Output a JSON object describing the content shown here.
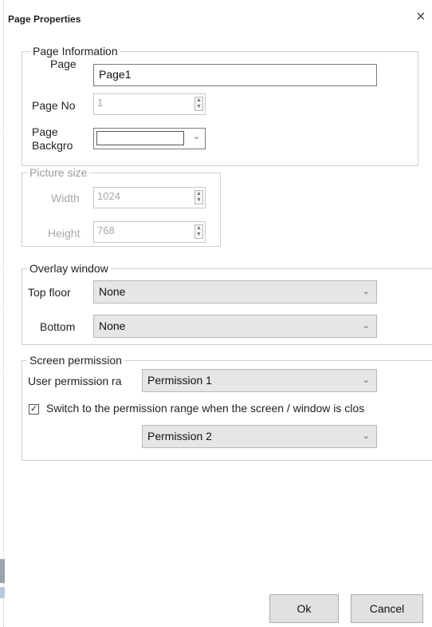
{
  "dialog": {
    "title": "Page Properties",
    "close_glyph": "×"
  },
  "page_information": {
    "legend": "Page Information",
    "page_label": "Page",
    "page_value": "Page1",
    "page_no_label": "Page No",
    "page_no_value": "1",
    "background_label_line1": "Page",
    "background_label_line2": "Backgro",
    "background_color": "#ffffff"
  },
  "picture_size": {
    "legend": "Picture size",
    "width_label": "Width",
    "width_value": "1024",
    "height_label": "Height",
    "height_value": "768"
  },
  "overlay_window": {
    "legend": "Overlay window",
    "top_label": "Top floor",
    "top_value": "None",
    "bottom_label": "Bottom",
    "bottom_value": "None"
  },
  "screen_permission": {
    "legend": "Screen permission",
    "user_perm_label": "User permission ra",
    "user_perm_value": "Permission 1",
    "switch_checked": true,
    "switch_label": "Switch to the permission range when the screen / window is clos",
    "switch_value": "Permission 2"
  },
  "buttons": {
    "ok": "Ok",
    "cancel": "Cancel"
  },
  "icons": {
    "chevron": "⌄",
    "spin_up": "▲",
    "spin_down": "▼",
    "check": "✓"
  }
}
